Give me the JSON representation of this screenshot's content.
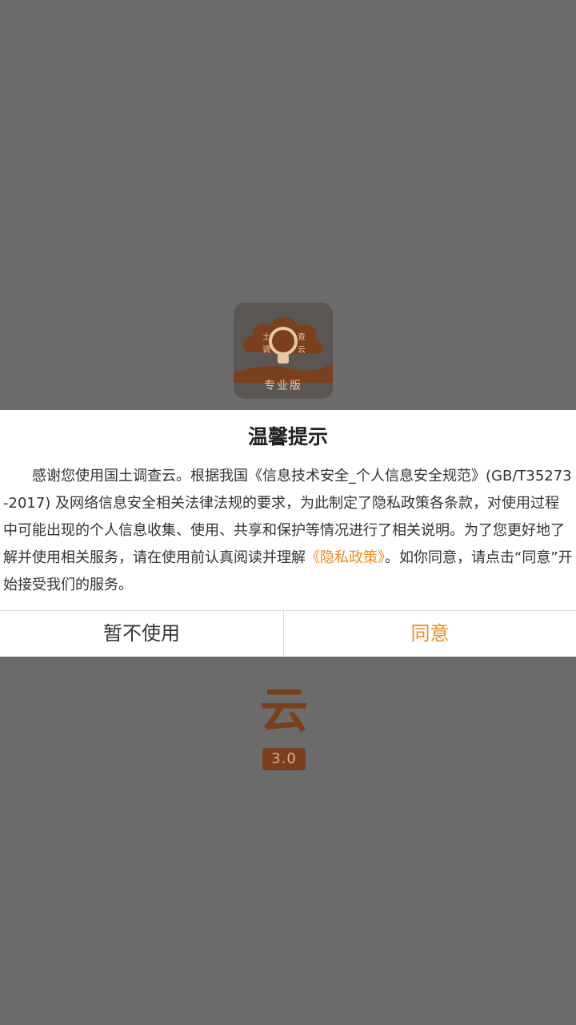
{
  "splash": {
    "logo_text": [
      "土",
      "查",
      "调",
      "云"
    ],
    "edition": "专业版",
    "title_chars": [
      "云"
    ],
    "version": "3.0"
  },
  "dialog": {
    "title": "温馨提示",
    "body_before_link": "感谢您使用国土调查云。根据我国《信息技术安全_个人信息安全规范》(GB/T35273-2017) 及网络信息安全相关法律法规的要求，为此制定了隐私政策各条款，对使用过程中可能出现的个人信息收集、使用、共享和保护等情况进行了相关说明。为了您更好地了解并使用相关服务，请在使用前认真阅读并理解",
    "policy_link": "《隐私政策》",
    "body_after_link": "。如你同意，请点击“同意”开始接受我们的服务。",
    "decline_label": "暂不使用",
    "agree_label": "同意"
  },
  "colors": {
    "accent": "#f08a24",
    "overlay": "#6b6b6b",
    "brand": "#7a3f1c"
  }
}
